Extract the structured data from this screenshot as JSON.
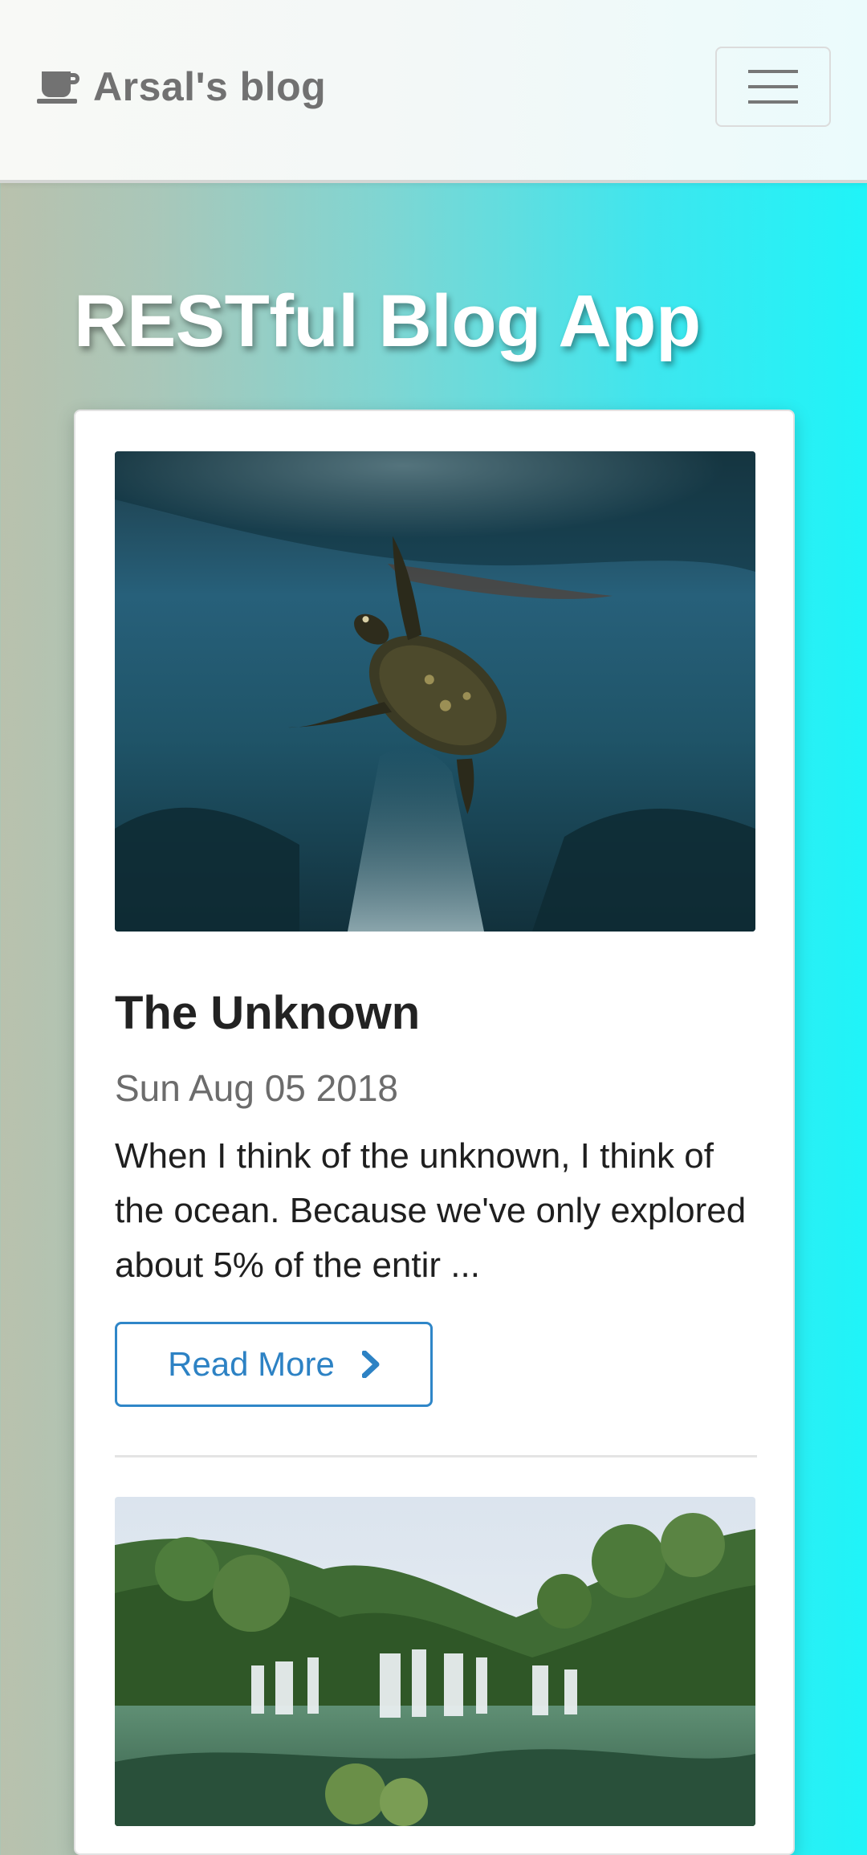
{
  "navbar": {
    "brand_icon": "coffee-cup-icon",
    "brand_label": "Arsal's blog",
    "menu_icon": "hamburger-menu-icon"
  },
  "page": {
    "title": "RESTful Blog App"
  },
  "posts": [
    {
      "image_desc": "sea-turtle-underwater-photo",
      "title": "The Unknown",
      "date": "Sun Aug 05 2018",
      "excerpt": "When I think of the unknown, I think of the ocean. Because we've only explored about 5% of the entir ...",
      "read_more_label": "Read More",
      "read_more_icon": "chevron-right-icon"
    },
    {
      "image_desc": "waterfall-forest-photo"
    }
  ],
  "colors": {
    "accent": "#2f86c8",
    "brand_text": "#717171",
    "title_text": "#ffffff"
  }
}
